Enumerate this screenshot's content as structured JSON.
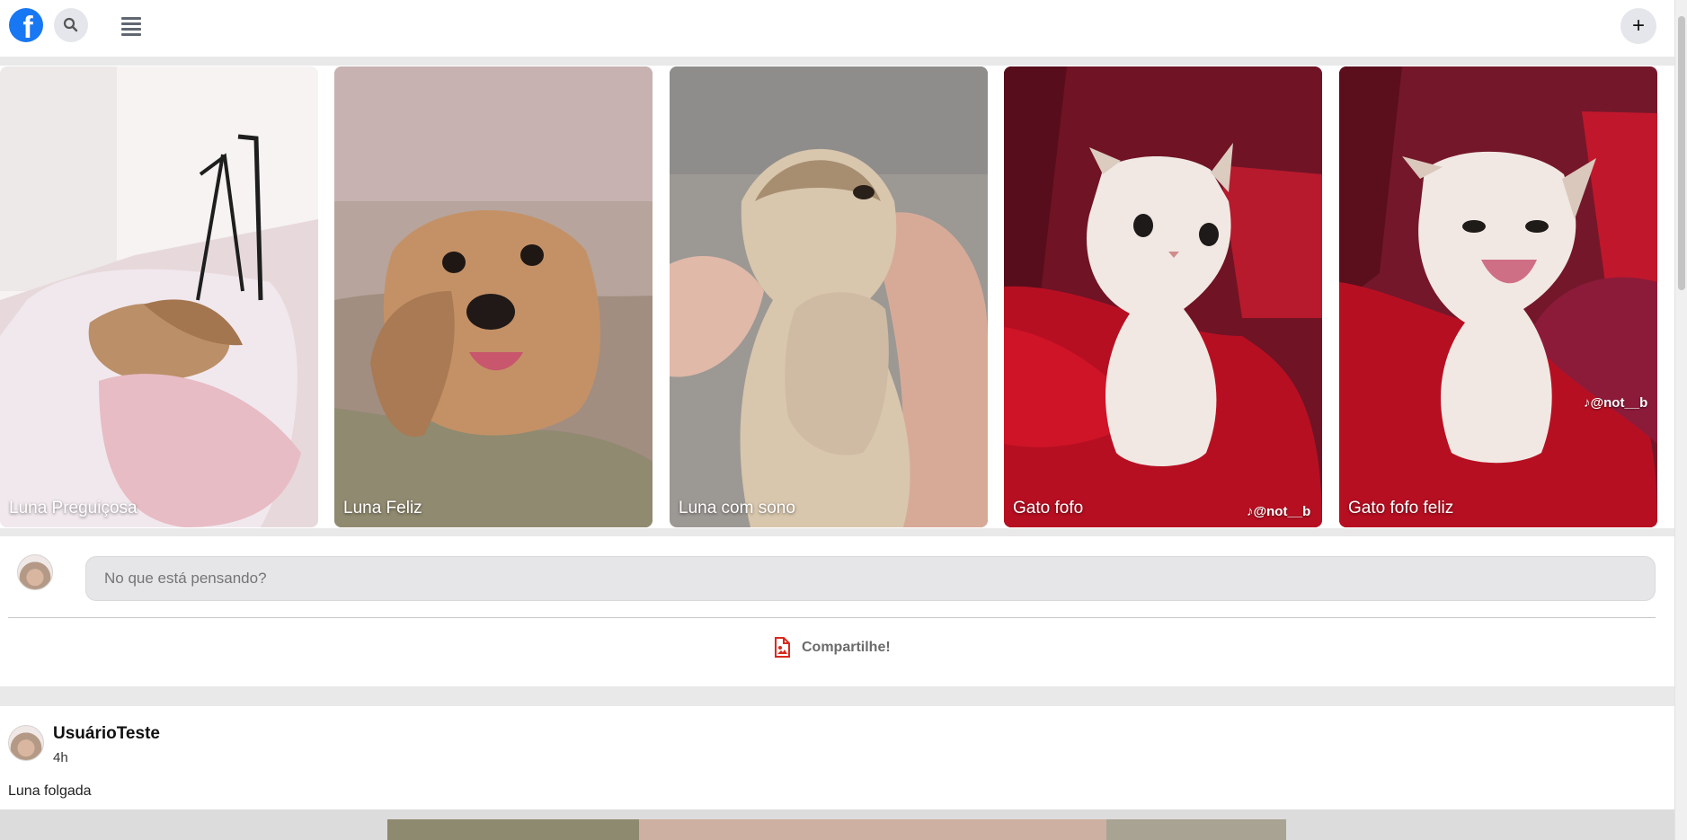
{
  "header": {
    "logo": "f",
    "search_icon": "search-icon",
    "menu_icon": "menu-icon",
    "add_label": "+"
  },
  "stories": [
    {
      "title": "Luna Preguiçosa",
      "watermark": ""
    },
    {
      "title": "Luna Feliz",
      "watermark": ""
    },
    {
      "title": "Luna com sono",
      "watermark": ""
    },
    {
      "title": "Gato fofo",
      "watermark": "@not__b"
    },
    {
      "title": "Gato fofo feliz",
      "watermark": "@not__b"
    }
  ],
  "composer": {
    "placeholder": "No que está pensando?",
    "share_label": "Compartilhe!",
    "share_icon": "document-image-icon"
  },
  "post": {
    "author": "UsuárioTeste",
    "time": "4h",
    "text": "Luna folgada"
  },
  "colors": {
    "brand": "#1877f2",
    "share_icon": "#d9291c"
  }
}
